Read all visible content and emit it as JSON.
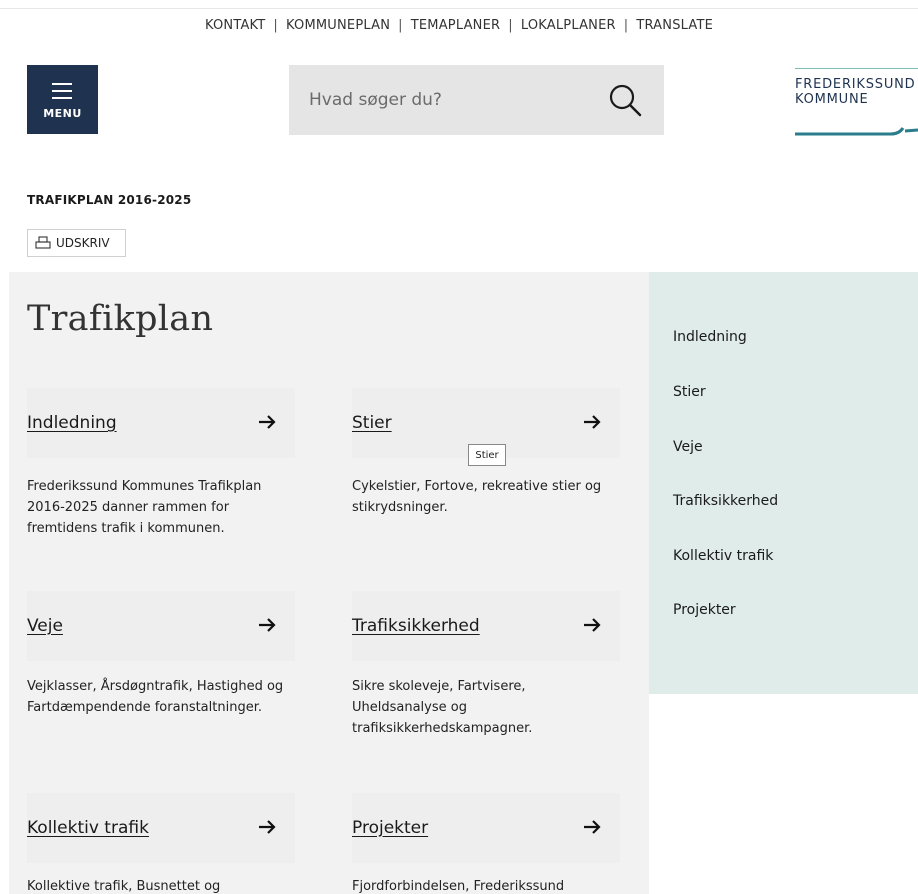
{
  "top_nav": [
    "KONTAKT",
    "KOMMUNEPLAN",
    "TEMAPLANER",
    "LOKALPLANER",
    "TRANSLATE"
  ],
  "menu": {
    "label": "MENU"
  },
  "search": {
    "placeholder": "Hvad søger du?"
  },
  "logo": {
    "line1": "FREDERIKSSUND",
    "line2": "KOMMUNE"
  },
  "breadcrumb": "TRAFIKPLAN 2016-2025",
  "print_label": "UDSKRIV",
  "page_title": "Trafikplan",
  "cards": [
    {
      "title": "Indledning",
      "desc": [
        "Frederikssund Kommunes Trafikplan",
        "2016-2025 danner rammen for",
        "fremtidens trafik i kommunen."
      ]
    },
    {
      "title": "Stier",
      "desc": [
        "Cykelstier, Fortove, rekreative stier og",
        "stikrydsninger."
      ]
    },
    {
      "title": "Veje",
      "desc": [
        "Vejklasser, Årsdøgntrafik, Hastighed og",
        "Fartdæmpendende foranstaltninger."
      ]
    },
    {
      "title": "Trafiksikkerhed",
      "desc": [
        "Sikre skoleveje, Fartvisere,",
        "Uheldsanalyse og",
        "trafiksikkerhedskampagner."
      ]
    },
    {
      "title": "Kollektiv trafik",
      "desc": [
        "Kollektive trafik, Busnettet og"
      ]
    },
    {
      "title": "Projekter",
      "desc": [
        "Fjordforbindelsen, Frederikssund"
      ]
    }
  ],
  "tooltip": "Stier",
  "side_nav": [
    "Indledning",
    "Stier",
    "Veje",
    "Trafiksikkerhed",
    "Kollektiv trafik",
    "Projekter"
  ],
  "colors": {
    "menu_bg": "#1f3350",
    "search_bg": "#e5e5e5",
    "content_bg": "#f2f2f2",
    "side_bg": "#e0ecea",
    "logo_accent": "#2a7d8c"
  }
}
